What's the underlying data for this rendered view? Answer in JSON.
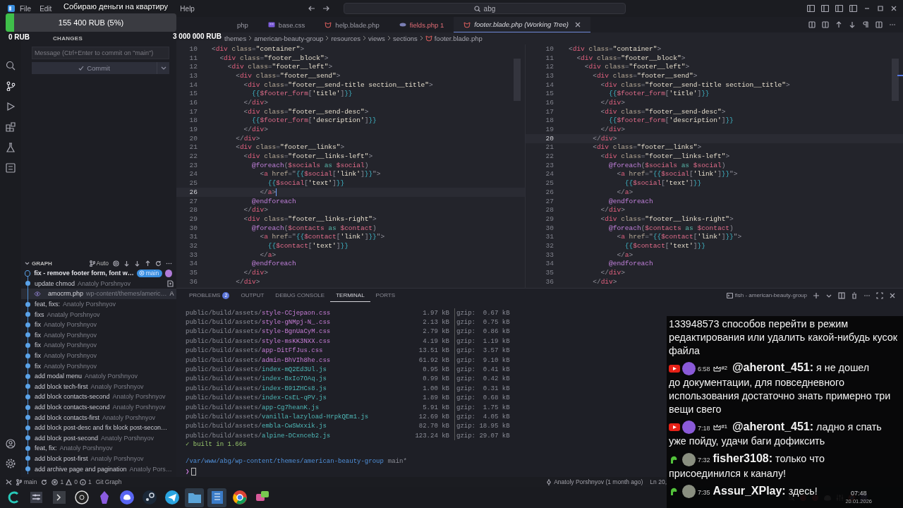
{
  "donation": {
    "title": "Собираю деньги на квартиру",
    "amount": "155 400 RUB (5%)",
    "level": 0.05,
    "min": "0 RUB",
    "max": "3 000 000 RUB"
  },
  "menu": [
    "File",
    "Edit",
    "Help"
  ],
  "search": {
    "value": "abg"
  },
  "source_control": {
    "header": "CHANGES",
    "message_placeholder": "Message (Ctrl+Enter to commit on \"main\")",
    "commit_label": "Commit"
  },
  "graph": {
    "header": "GRAPH",
    "mode": "Auto",
    "branch_badge": "main",
    "commits": [
      {
        "message": "fix - remove footer form, font w…",
        "head": true,
        "expanded": false
      },
      {
        "message": "update chmod",
        "author": "Anatoly Porshnyov",
        "head": false,
        "expanded": true,
        "children": [
          {
            "file": "amocrm.php",
            "path": "wp-content/themes/americ…",
            "status": "A"
          }
        ]
      },
      {
        "message": "feat, fixs:",
        "author": "Anatoly Porshnyov",
        "head": false,
        "expanded": false
      },
      {
        "message": "fixs",
        "author": "Anataly Porshnyov",
        "head": false,
        "expanded": false
      },
      {
        "message": "fix",
        "author": "Anatoly Porshnyov",
        "head": false,
        "expanded": false
      },
      {
        "message": "fix",
        "author": "Anatoly Porshnyov",
        "head": false,
        "expanded": false
      },
      {
        "message": "fix",
        "author": "Anatoly Porshnyov",
        "head": false,
        "expanded": false
      },
      {
        "message": "fix",
        "author": "Anatoly Porshnyov",
        "head": false,
        "expanded": false
      },
      {
        "message": "fix",
        "author": "Anatoly Porshnyov",
        "head": false,
        "expanded": false
      },
      {
        "message": "add modal menu",
        "author": "Anatoly Porshnyov",
        "head": false,
        "expanded": false
      },
      {
        "message": "add block tech-first",
        "author": "Anatoly Porshnyov",
        "head": false,
        "expanded": false
      },
      {
        "message": "add block contacts-second",
        "author": "Anatoly Porshnyov",
        "head": false,
        "expanded": false
      },
      {
        "message": "add block contacts-second",
        "author": "Anatoly Porshnyov",
        "head": false,
        "expanded": false
      },
      {
        "message": "add block contacts-first",
        "author": "Anatoly Porshnyov",
        "head": false,
        "expanded": false
      },
      {
        "message": "add block post-desc and fix block post-secon…",
        "head": false,
        "expanded": false
      },
      {
        "message": "add block post-second",
        "author": "Anatoly Porshnyov",
        "head": false,
        "expanded": false
      },
      {
        "message": "feat, fix:",
        "author": "Anatoly Porshnyov",
        "head": false,
        "expanded": false
      },
      {
        "message": "add block post-first",
        "author": "Anatoly Porshnyov",
        "head": false,
        "expanded": false
      },
      {
        "message": "add archive page and pagination",
        "author": "Anatoly Pors…",
        "head": false,
        "expanded": false
      }
    ]
  },
  "tabs": [
    {
      "label": "php",
      "kind": "plain",
      "selected": false,
      "error": false
    },
    {
      "label": "base.css",
      "kind": "css",
      "selected": false,
      "error": false
    },
    {
      "label": "help.blade.php",
      "kind": "blade",
      "selected": false,
      "error": false
    },
    {
      "label": "fields.php 1",
      "kind": "php",
      "selected": false,
      "error": true
    },
    {
      "label": "footer.blade.php (Working Tree)",
      "kind": "blade",
      "selected": true,
      "error": false
    }
  ],
  "breadcrumb": [
    "themes",
    "american-beauty-group",
    "resources",
    "views",
    "sections",
    "footer.blade.php"
  ],
  "diff_panes": [
    {
      "lines": [
        {
          "number": "10",
          "code": "<div class=\"container\">",
          "current": false
        },
        {
          "number": "11",
          "code": "  <div class=\"footer__block\">",
          "current": false
        },
        {
          "number": "12",
          "code": "    <div class=\"footer__left\">",
          "current": false
        },
        {
          "number": "13",
          "code": "      <div class=\"footer__send\">",
          "current": false
        },
        {
          "number": "14",
          "code": "        <div class=\"footer__send-title section__title\">",
          "current": false
        },
        {
          "number": "15",
          "code": "          {{$footer_form['title']}}",
          "current": false
        },
        {
          "number": "16",
          "code": "        </div>",
          "current": false
        },
        {
          "number": "17",
          "code": "        <div class=\"footer__send-desc\">",
          "current": false
        },
        {
          "number": "18",
          "code": "          {{$footer_form['description']}}",
          "current": false
        },
        {
          "number": "19",
          "code": "        </div>",
          "current": false
        },
        {
          "number": "20",
          "code": "      </div>",
          "current": false
        },
        {
          "number": "21",
          "code": "      <div class=\"footer__links\">",
          "current": false
        },
        {
          "number": "22",
          "code": "        <div class=\"footer__links-left\">",
          "current": false
        },
        {
          "number": "23",
          "code": "          @foreach($socials as $social)",
          "current": false
        },
        {
          "number": "24",
          "code": "            <a href=\"{{$social['link']}}\">",
          "current": false
        },
        {
          "number": "25",
          "code": "              {{$social['text']}}",
          "current": false
        },
        {
          "number": "26",
          "code": "            </a>",
          "current": true
        },
        {
          "number": "27",
          "code": "          @endforeach",
          "current": false
        },
        {
          "number": "28",
          "code": "        </div>",
          "current": false
        },
        {
          "number": "29",
          "code": "        <div class=\"footer__links-right\">",
          "current": false
        },
        {
          "number": "30",
          "code": "          @foreach($contacts as $contact)",
          "current": false
        },
        {
          "number": "31",
          "code": "            <a href=\"{{$contact['link']}}\">",
          "current": false
        },
        {
          "number": "32",
          "code": "              {{$contact['text']}}",
          "current": false
        },
        {
          "number": "33",
          "code": "            </a>",
          "current": false
        },
        {
          "number": "34",
          "code": "          @endforeach",
          "current": false
        },
        {
          "number": "35",
          "code": "        </div>",
          "current": false
        },
        {
          "number": "36",
          "code": "      </div>",
          "current": false
        }
      ]
    },
    {
      "lines": [
        {
          "number": "10",
          "code": "<div class=\"container\">",
          "current": false
        },
        {
          "number": "11",
          "code": "  <div class=\"footer__block\">",
          "current": false
        },
        {
          "number": "12",
          "code": "    <div class=\"footer__left\">",
          "current": false
        },
        {
          "number": "13",
          "code": "      <div class=\"footer__send\">",
          "current": false
        },
        {
          "number": "14",
          "code": "        <div class=\"footer__send-title section__title\">",
          "current": false
        },
        {
          "number": "15",
          "code": "          {{$footer_form['title']}}",
          "current": false
        },
        {
          "number": "16",
          "code": "        </div>",
          "current": false
        },
        {
          "number": "17",
          "code": "        <div class=\"footer__send-desc\">",
          "current": false
        },
        {
          "number": "18",
          "code": "          {{$footer_form['description']}}",
          "current": false
        },
        {
          "number": "19",
          "code": "        </div>",
          "current": false
        },
        {
          "number": "20",
          "code": "      </div>",
          "current": true
        },
        {
          "number": "21",
          "code": "      <div class=\"footer__links\">",
          "current": false
        },
        {
          "number": "22",
          "code": "        <div class=\"footer__links-left\">",
          "current": false
        },
        {
          "number": "23",
          "code": "          @foreach($socials as $social)",
          "current": false
        },
        {
          "number": "24",
          "code": "            <a href=\"{{$social['link']}}\">",
          "current": false
        },
        {
          "number": "25",
          "code": "              {{$social['text']}}",
          "current": false
        },
        {
          "number": "26",
          "code": "            </a>",
          "current": false
        },
        {
          "number": "27",
          "code": "          @endforeach",
          "current": false
        },
        {
          "number": "28",
          "code": "        </div>",
          "current": false
        },
        {
          "number": "29",
          "code": "        <div class=\"footer__links-right\">",
          "current": false
        },
        {
          "number": "30",
          "code": "          @foreach($contacts as $contact)",
          "current": false
        },
        {
          "number": "31",
          "code": "            <a href=\"{{$contact['link']}}\">",
          "current": false
        },
        {
          "number": "32",
          "code": "              {{$contact['text']}}",
          "current": false
        },
        {
          "number": "33",
          "code": "            </a>",
          "current": false
        },
        {
          "number": "34",
          "code": "          @endforeach",
          "current": false
        },
        {
          "number": "35",
          "code": "        </div>",
          "current": false
        },
        {
          "number": "36",
          "code": "      </div>",
          "current": false
        }
      ]
    }
  ],
  "panel": {
    "tabs": [
      {
        "label": "PROBLEMS",
        "badge": "2",
        "selected": false
      },
      {
        "label": "OUTPUT",
        "selected": false
      },
      {
        "label": "DEBUG CONSOLE",
        "selected": false
      },
      {
        "label": "TERMINAL",
        "selected": true
      },
      {
        "label": "PORTS",
        "selected": false
      }
    ],
    "terminal_name": "fish - american-beauty-group",
    "terminal_rows": [
      {
        "dir": "public/build/assets/",
        "file": "style-CCjepaon.css",
        "kind": "css",
        "size": "1.97 kB",
        "gzip": "gzip:  0.67 kB"
      },
      {
        "dir": "public/build/assets/",
        "file": "style-gNMpj-N_.css",
        "kind": "css",
        "size": "2.13 kB",
        "gzip": "gzip:  0.75 kB"
      },
      {
        "dir": "public/build/assets/",
        "file": "style-BgnUaCyM.css",
        "kind": "css",
        "size": "2.79 kB",
        "gzip": "gzip:  0.86 kB"
      },
      {
        "dir": "public/build/assets/",
        "file": "style-msKK3NXX.css",
        "kind": "css",
        "size": "4.19 kB",
        "gzip": "gzip:  1.19 kB"
      },
      {
        "dir": "public/build/assets/",
        "file": "app-DitFfJus.css",
        "kind": "css",
        "size": "13.51 kB",
        "gzip": "gzip:  3.57 kB"
      },
      {
        "dir": "public/build/assets/",
        "file": "admin-BhVIh8he.css",
        "kind": "css",
        "size": "61.92 kB",
        "gzip": "gzip:  9.10 kB"
      },
      {
        "dir": "public/build/assets/",
        "file": "index-mQ2Ed3Ul.js",
        "kind": "js",
        "size": "0.95 kB",
        "gzip": "gzip:  0.41 kB"
      },
      {
        "dir": "public/build/assets/",
        "file": "index-BxIo7OAq.js",
        "kind": "js",
        "size": "0.99 kB",
        "gzip": "gzip:  0.42 kB"
      },
      {
        "dir": "public/build/assets/",
        "file": "index-B91ZHCs8.js",
        "kind": "js",
        "size": "1.00 kB",
        "gzip": "gzip:  0.31 kB"
      },
      {
        "dir": "public/build/assets/",
        "file": "index-CsEL-qPV.js",
        "kind": "js",
        "size": "1.89 kB",
        "gzip": "gzip:  0.68 kB"
      },
      {
        "dir": "public/build/assets/",
        "file": "app-Cg7heanK.js",
        "kind": "js",
        "size": "5.91 kB",
        "gzip": "gzip:  1.75 kB"
      },
      {
        "dir": "public/build/assets/",
        "file": "vanilla-lazyload-HrpkQEm1.js",
        "kind": "js",
        "size": "12.69 kB",
        "gzip": "gzip:  4.05 kB"
      },
      {
        "dir": "public/build/assets/",
        "file": "embla-CwSWxxik.js",
        "kind": "js",
        "size": "82.70 kB",
        "gzip": "gzip: 18.95 kB"
      },
      {
        "dir": "public/build/assets/",
        "file": "alpine-DCxnceb2.js",
        "kind": "js",
        "size": "123.24 kB",
        "gzip": "gzip: 29.07 kB"
      }
    ],
    "built": "✓ built in 1.66s",
    "cwd": "/var/www/abg/wp-content/themes/american-beauty-group",
    "git": "main*",
    "prompt": "❯"
  },
  "status_bar": {
    "branch": "main",
    "errors": "1",
    "warnings": "0",
    "infos": "1",
    "git_graph": "Git Graph",
    "blame": "Anatoly Porshnyov (1 month ago)",
    "position": "Ln 20,"
  },
  "chat": [
    {
      "text": "133948573 способов перейти в режим редактирования или удалить какой-нибудь кусок файла"
    },
    {
      "kind": "youtube",
      "time": "6:58",
      "rank": "#2",
      "user": "@aheront_451:",
      "text": "я не дошел",
      "continuation": "до документации, для повседневного использования достаточно знать примерно три вещи свего"
    },
    {
      "kind": "youtube",
      "time": "7:18",
      "rank": "#1",
      "user": "@aheront_451:",
      "text": "ладно я спать",
      "continuation": "уже пойду, удачи баги дофиксить"
    },
    {
      "kind": "kick",
      "time": "7:32",
      "user": "fisher3108:",
      "text": "только что",
      "continuation": "присоединился к каналу!"
    },
    {
      "kind": "kick",
      "time": "7:35",
      "user": "Assur_XPlay:",
      "text": "здесь!"
    }
  ],
  "clock": {
    "time": "07:48",
    "date": "20.01.2026"
  }
}
